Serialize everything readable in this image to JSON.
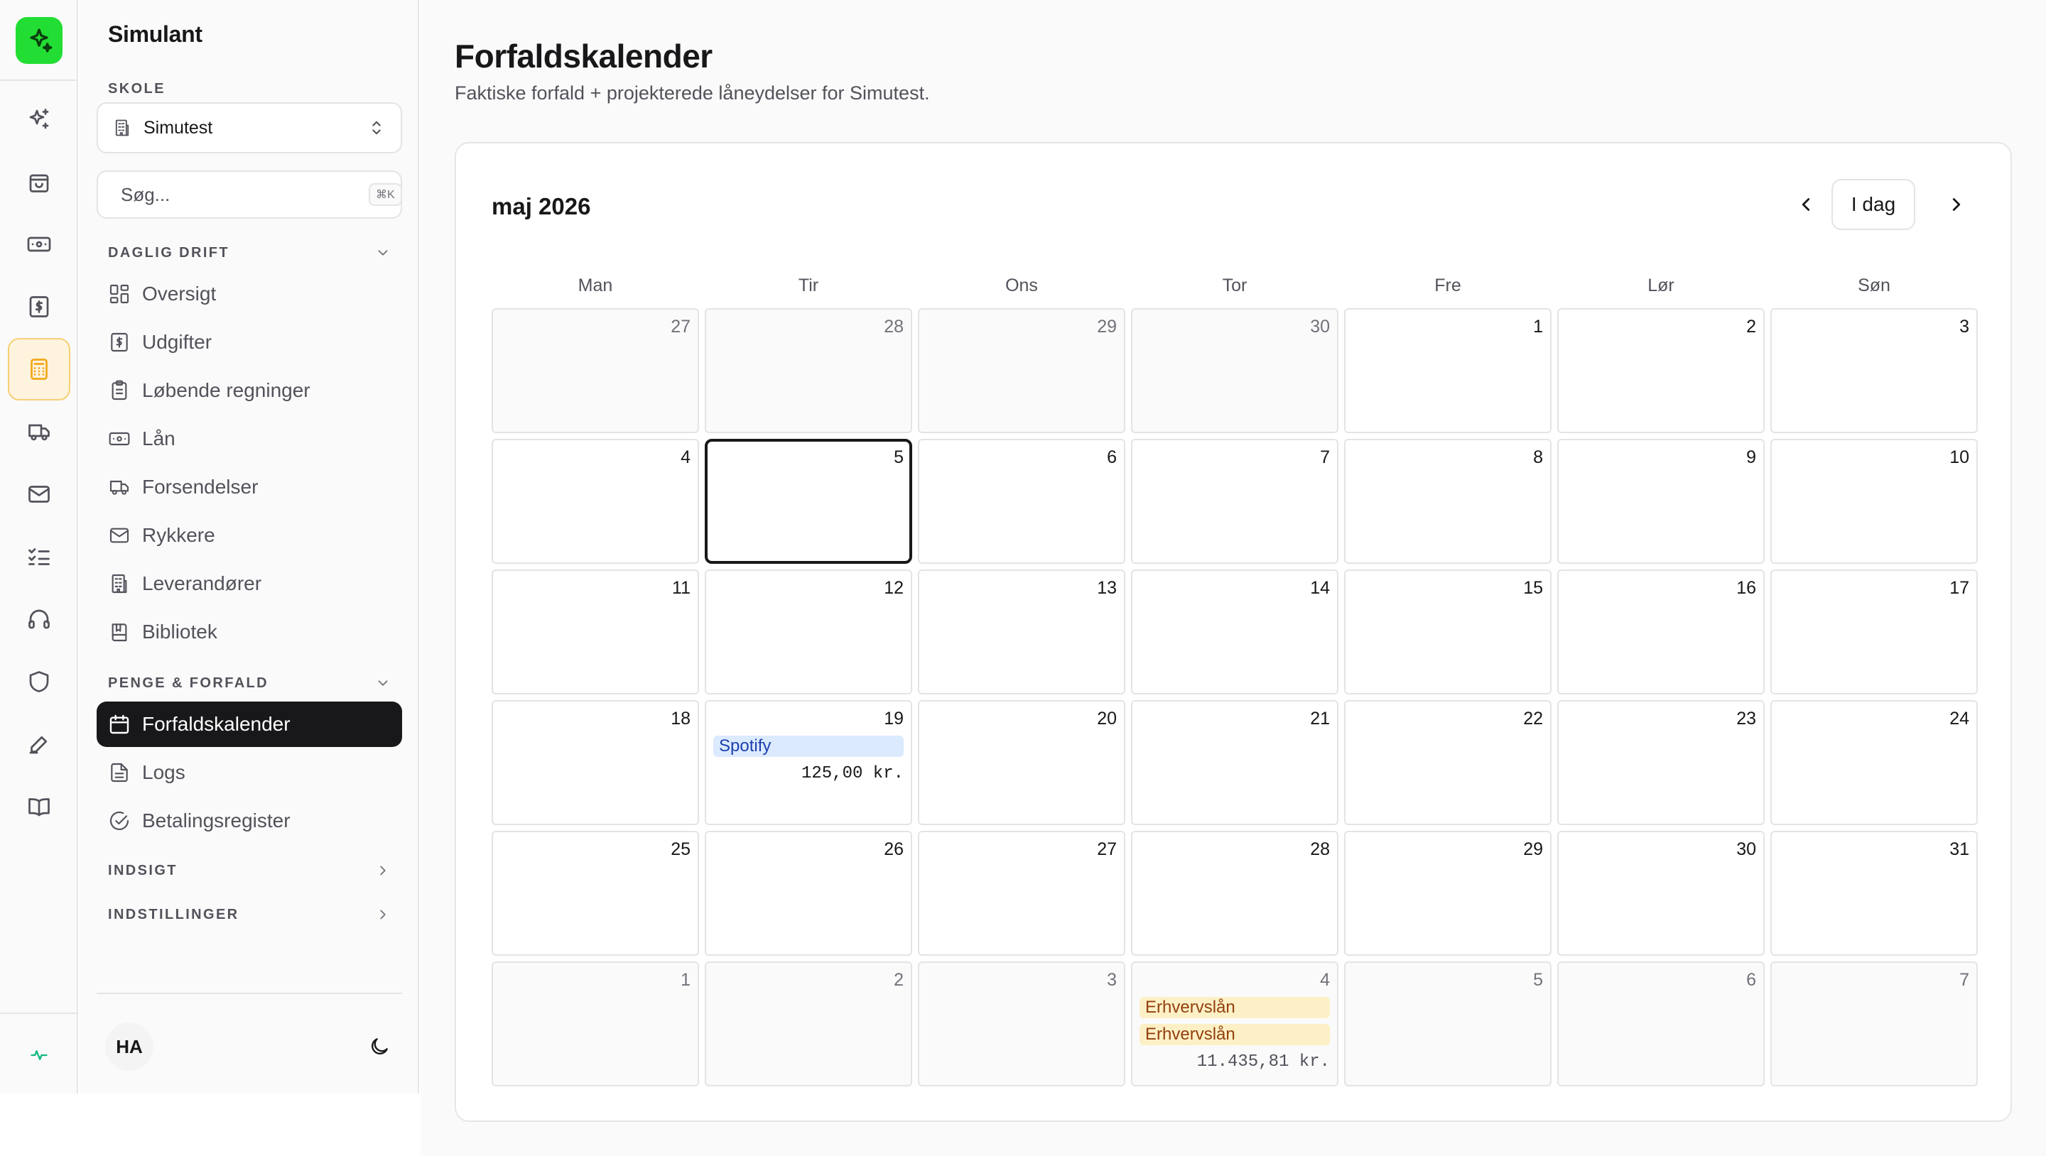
{
  "app": {
    "name": "Simulant"
  },
  "school": {
    "label": "SKOLE",
    "value": "Simutest"
  },
  "search": {
    "placeholder": "Søg...",
    "shortcut": "⌘K"
  },
  "nav_groups": [
    {
      "label": "DAGLIG DRIFT",
      "expanded": true
    },
    {
      "label": "PENGE & FORFALD",
      "expanded": true
    },
    {
      "label": "INDSIGT",
      "expanded": false
    },
    {
      "label": "INDSTILLINGER",
      "expanded": false
    }
  ],
  "nav_items": [
    {
      "label": "Oversigt",
      "icon": "layout-grid-icon"
    },
    {
      "label": "Udgifter",
      "icon": "receipt-dollar-icon"
    },
    {
      "label": "Løbende regninger",
      "icon": "clipboard-list-icon"
    },
    {
      "label": "Lån",
      "icon": "banknote-icon"
    },
    {
      "label": "Forsendelser",
      "icon": "truck-icon"
    },
    {
      "label": "Rykkere",
      "icon": "mail-icon"
    },
    {
      "label": "Leverandører",
      "icon": "building-icon"
    },
    {
      "label": "Bibliotek",
      "icon": "book-icon"
    },
    {
      "label": "Forfaldskalender",
      "icon": "calendar-icon",
      "active": true
    },
    {
      "label": "Logs",
      "icon": "file-text-icon"
    },
    {
      "label": "Betalingsregister",
      "icon": "check-circle-icon"
    }
  ],
  "user": {
    "initials": "HA"
  },
  "accent_color": "#22dd33",
  "page": {
    "title": "Forfaldskalender",
    "subtitle": "Faktiske forfald + projekterede låneydelser for Simutest."
  },
  "calendar": {
    "month_label": "maj 2026",
    "today_label": "I dag",
    "weekdays": [
      "Man",
      "Tir",
      "Ons",
      "Tor",
      "Fre",
      "Lør",
      "Søn"
    ],
    "today": 5,
    "weeks": [
      [
        {
          "d": "27",
          "o": true
        },
        {
          "d": "28",
          "o": true
        },
        {
          "d": "29",
          "o": true
        },
        {
          "d": "30",
          "o": true
        },
        {
          "d": "1"
        },
        {
          "d": "2"
        },
        {
          "d": "3"
        }
      ],
      [
        {
          "d": "4"
        },
        {
          "d": "5",
          "today": true
        },
        {
          "d": "6"
        },
        {
          "d": "7"
        },
        {
          "d": "8"
        },
        {
          "d": "9"
        },
        {
          "d": "10"
        }
      ],
      [
        {
          "d": "11"
        },
        {
          "d": "12"
        },
        {
          "d": "13"
        },
        {
          "d": "14"
        },
        {
          "d": "15"
        },
        {
          "d": "16"
        },
        {
          "d": "17"
        }
      ],
      [
        {
          "d": "18"
        },
        {
          "d": "19",
          "events": [
            {
              "label": "Spotify",
              "color": "blue"
            }
          ],
          "amount": "125,00 kr."
        },
        {
          "d": "20"
        },
        {
          "d": "21"
        },
        {
          "d": "22"
        },
        {
          "d": "23"
        },
        {
          "d": "24"
        }
      ],
      [
        {
          "d": "25"
        },
        {
          "d": "26"
        },
        {
          "d": "27"
        },
        {
          "d": "28"
        },
        {
          "d": "29"
        },
        {
          "d": "30"
        },
        {
          "d": "31"
        }
      ],
      [
        {
          "d": "1",
          "o": true
        },
        {
          "d": "2",
          "o": true
        },
        {
          "d": "3",
          "o": true
        },
        {
          "d": "4",
          "o": true,
          "events": [
            {
              "label": "Erhvervslån",
              "color": "amber"
            },
            {
              "label": "Erhvervslån",
              "color": "amber"
            }
          ],
          "amount": "11.435,81 kr."
        },
        {
          "d": "5",
          "o": true
        },
        {
          "d": "6",
          "o": true
        },
        {
          "d": "7",
          "o": true
        }
      ]
    ]
  }
}
